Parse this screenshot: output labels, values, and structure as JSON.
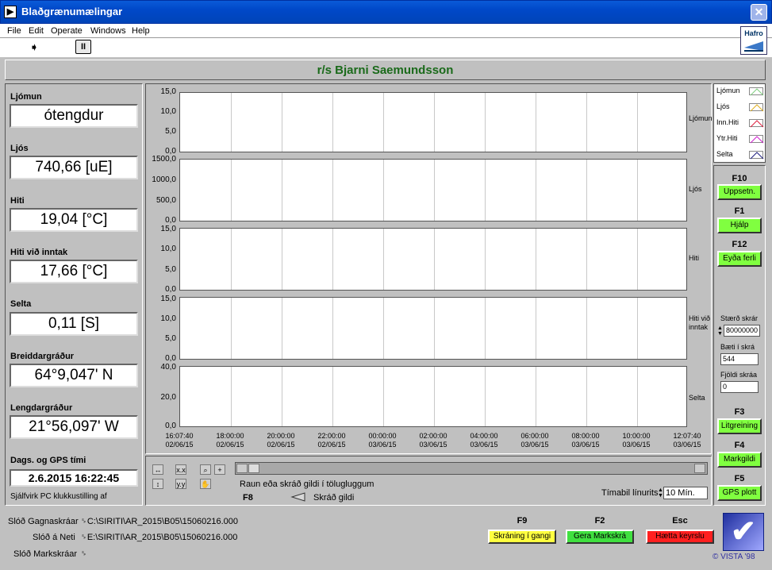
{
  "window": {
    "title": "Blaðgrænumælingar",
    "close": "✕",
    "icon": "▶"
  },
  "menu": [
    "File",
    "Edit",
    "Operate",
    "Windows",
    "Help"
  ],
  "toolbar": {
    "run": "➧",
    "pause": "II",
    "logo": "Hafro"
  },
  "header": {
    "ship": "r/s Bjarni Saemundsson"
  },
  "indicators": [
    {
      "label": "Ljómun",
      "value": "ótengdur"
    },
    {
      "label": "Ljós",
      "value": "740,66  [uE]"
    },
    {
      "label": "Hiti",
      "value": "19,04  [°C]"
    },
    {
      "label": "Hiti við inntak",
      "value": "17,66  [°C]"
    },
    {
      "label": "Selta",
      "value": "0,11  [S]"
    },
    {
      "label": "Breiddargráður",
      "value": "64°9,047' N"
    },
    {
      "label": "Lengdargráður",
      "value": "21°56,097' W"
    }
  ],
  "gps": {
    "label": "Dags. og GPS tími",
    "value": "2.6.2015 16:22:45",
    "clock_note": "Sjálfvirk PC klukkustilling af"
  },
  "plots": [
    {
      "name": "Ljómun",
      "ticks": [
        "15,0",
        "10,0",
        "5,0",
        "0,0"
      ]
    },
    {
      "name": "Ljós",
      "ticks": [
        "1500,0",
        "1000,0",
        "500,0",
        "0,0"
      ]
    },
    {
      "name": "Hiti",
      "ticks": [
        "15,0",
        "10,0",
        "5,0",
        "0,0"
      ]
    },
    {
      "name": "Hiti við inntak",
      "ticks": [
        "15,0",
        "10,0",
        "5,0",
        "0,0"
      ]
    },
    {
      "name": "Selta",
      "ticks": [
        "40,0",
        "20,0",
        "0,0"
      ]
    }
  ],
  "xaxis": [
    [
      "16:07:40",
      "02/06/15"
    ],
    [
      "18:00:00",
      "02/06/15"
    ],
    [
      "20:00:00",
      "02/06/15"
    ],
    [
      "22:00:00",
      "02/06/15"
    ],
    [
      "00:00:00",
      "03/06/15"
    ],
    [
      "02:00:00",
      "03/06/15"
    ],
    [
      "04:00:00",
      "03/06/15"
    ],
    [
      "06:00:00",
      "03/06/15"
    ],
    [
      "08:00:00",
      "03/06/15"
    ],
    [
      "10:00:00",
      "03/06/15"
    ],
    [
      "12:07:40",
      "03/06/15"
    ]
  ],
  "legend": [
    {
      "name": "Ljómun",
      "color": "#80d080"
    },
    {
      "name": "Ljós",
      "color": "#e0b020"
    },
    {
      "name": "Inn.Hiti",
      "color": "#e02040"
    },
    {
      "name": "Ytr.Hiti",
      "color": "#d020d0"
    },
    {
      "name": "Selta",
      "color": "#202080"
    }
  ],
  "functions": {
    "f10": {
      "key": "F10",
      "label": "Uppsetn."
    },
    "f1": {
      "key": "F1",
      "label": "Hjálp"
    },
    "f12": {
      "key": "F12",
      "label": "Eyða ferli"
    },
    "file_size_label": "Stærð skrár",
    "file_size": "80000000",
    "bytes_label": "Bæti í skrá",
    "bytes": "544",
    "files_label": "Fjöldi skráa",
    "files": "0",
    "f3": {
      "key": "F3",
      "label": "Litgreining"
    },
    "f4": {
      "key": "F4",
      "label": "Markgildi"
    },
    "f5": {
      "key": "F5",
      "label": "GPS plott"
    }
  },
  "bottom": {
    "raw_text": "Raun eða skráð gildi í tölugluggum",
    "f8": "F8",
    "toggle_label": "Skráð gildi",
    "interval_label": "Tímabil línurits",
    "interval_value": "10 Mín."
  },
  "paths": [
    {
      "label": "Slóð Gagnaskráar",
      "value": "C:\\SIRITI\\AR_2015\\B05\\15060216.000"
    },
    {
      "label": "Slóð á Neti",
      "value": "E:\\SIRITI\\AR_2015\\B05\\15060216.000"
    },
    {
      "label": "Slóð Markskráar",
      "value": ""
    }
  ],
  "status": [
    {
      "key": "F9",
      "label": "Skráning í gangi",
      "color": "#ffff40"
    },
    {
      "key": "F2",
      "label": "Gera Markskrá",
      "color": "#40e040"
    },
    {
      "key": "Esc",
      "label": "Hætta keyrslu",
      "color": "#ff2020"
    }
  ],
  "vista": "© VISTA '98"
}
